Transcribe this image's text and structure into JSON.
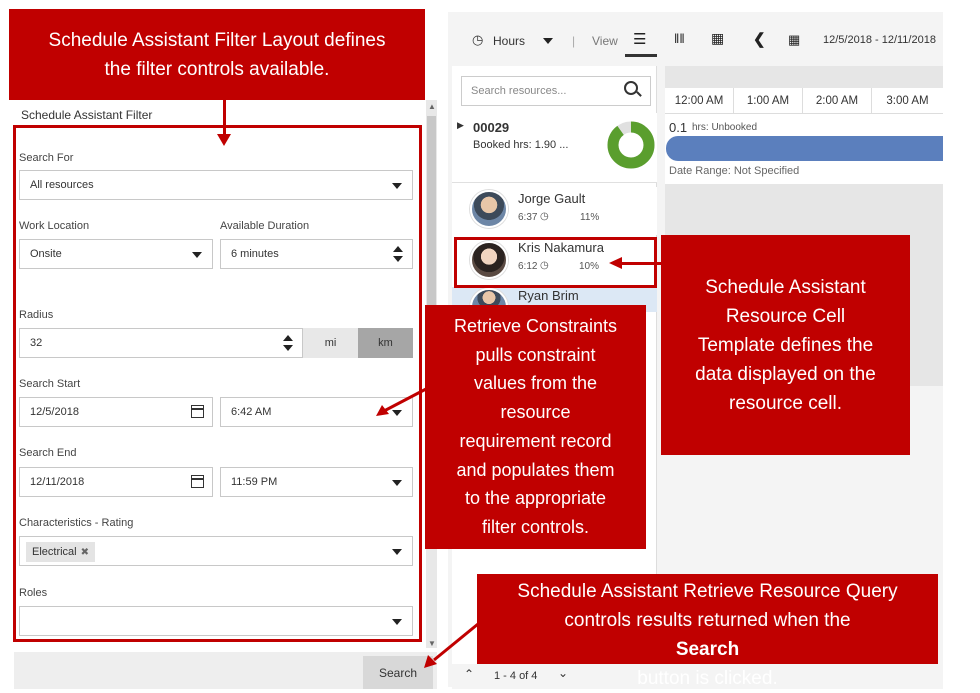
{
  "callouts": {
    "filter_layout": [
      "Schedule Assistant Filter Layout defines",
      "the filter controls available."
    ],
    "retrieve_constraints": [
      "Retrieve Constraints",
      "pulls constraint",
      "values from the",
      "resource",
      "requirement record",
      "and populates them",
      "to the appropriate",
      "filter controls."
    ],
    "resource_cell": [
      "Schedule Assistant",
      "Resource Cell",
      "Template defines the",
      "data displayed on the",
      "resource cell."
    ],
    "resource_query": {
      "line1": "Schedule Assistant Retrieve Resource Query",
      "line2_before": "controls results returned when the ",
      "line2_bold": "Search",
      "line3": "button is clicked."
    }
  },
  "filter": {
    "title": "Schedule Assistant Filter",
    "search_for": {
      "label": "Search For",
      "value": "All resources"
    },
    "work_location": {
      "label": "Work Location",
      "value": "Onsite"
    },
    "available_duration": {
      "label": "Available Duration",
      "value": "6 minutes"
    },
    "radius": {
      "label": "Radius",
      "value": "32",
      "unit_mi": "mi",
      "unit_km": "km",
      "selected_unit": "km"
    },
    "search_start": {
      "label": "Search Start",
      "date": "12/5/2018",
      "time": "6:42 AM"
    },
    "search_end": {
      "label": "Search End",
      "date": "12/11/2018",
      "time": "11:59 PM"
    },
    "characteristics": {
      "label": "Characteristics - Rating",
      "chip": "Electrical"
    },
    "roles": {
      "label": "Roles",
      "value": ""
    },
    "search_button": "Search"
  },
  "toolbar": {
    "hours_label": "Hours",
    "view_label": "View",
    "date_range": "12/5/2018 - 12/11/2018"
  },
  "resources": {
    "search_placeholder": "Search resources...",
    "requirement": {
      "name": "00029",
      "booked": "Booked hrs: 1.90 ...",
      "donut_fraction": 0.9
    },
    "items": [
      {
        "name": "Jorge Gault",
        "time": "6:37",
        "percent": "11%"
      },
      {
        "name": "Kris Nakamura",
        "time": "6:12",
        "percent": "10%"
      },
      {
        "name": "Ryan Brim"
      }
    ],
    "pager": "1 - 4 of 4"
  },
  "timeline": {
    "hours": [
      "12:00 AM",
      "1:00 AM",
      "2:00 AM",
      "3:00 AM"
    ],
    "unbooked_value": "0.1",
    "unbooked_label": "hrs: Unbooked",
    "date_range_label": "Date Range: Not Specified"
  },
  "colors": {
    "callout": "#c00000",
    "bar": "#5b7fbd",
    "donut": "#5a9e2e"
  }
}
